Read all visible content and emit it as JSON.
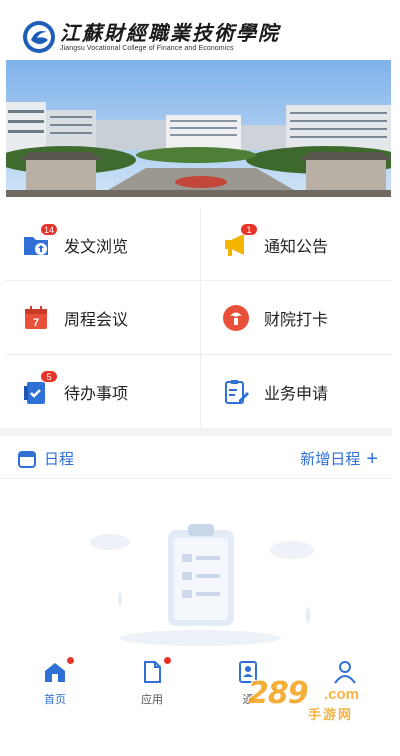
{
  "header": {
    "title_cn": "江蘇財經職業技術學院",
    "title_en": "Jiangsu Vocational College of Finance and Economics"
  },
  "grid": [
    {
      "label": "发文浏览",
      "icon": "folder-upload-icon",
      "badge": "14",
      "color": "#2f6fd6"
    },
    {
      "label": "通知公告",
      "icon": "megaphone-icon",
      "badge": "1",
      "color": "#f5b400"
    },
    {
      "label": "周程会议",
      "icon": "calendar-7-icon",
      "badge": "",
      "color": "#e8503a"
    },
    {
      "label": "财院打卡",
      "icon": "clock-in-icon",
      "badge": "",
      "color": "#e8503a"
    },
    {
      "label": "待办事项",
      "icon": "todo-check-icon",
      "badge": "5",
      "color": "#2f6fd6"
    },
    {
      "label": "业务申请",
      "icon": "form-edit-icon",
      "badge": "",
      "color": "#2f6fd6"
    }
  ],
  "schedule": {
    "title": "日程",
    "add_label": "新增日程",
    "add_symbol": "+"
  },
  "tabs": [
    {
      "label": "首页",
      "icon": "home-icon",
      "active": true,
      "dot": true
    },
    {
      "label": "应用",
      "icon": "document-icon",
      "active": false,
      "dot": true
    },
    {
      "label": "通",
      "icon": "contacts-icon",
      "active": false,
      "dot": false
    },
    {
      "label": "",
      "icon": "user-icon",
      "active": false,
      "dot": false
    }
  ],
  "watermark": {
    "number": "289",
    "domain": ".com",
    "cn": "手游网"
  },
  "colors": {
    "accent": "#2f6fd6",
    "badge": "#e8332a",
    "watermark": "#f5a623"
  }
}
